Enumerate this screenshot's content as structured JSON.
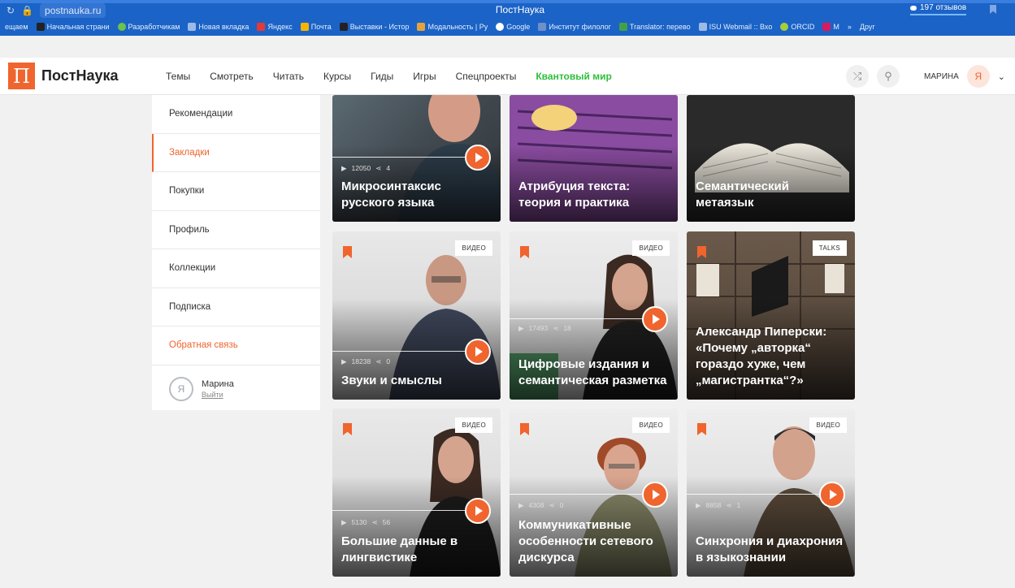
{
  "browser": {
    "url": "postnauka.ru",
    "title": "ПостНаука",
    "reviews": "197 отзывов",
    "bookmarks": [
      "ещаем",
      "Начальная страни",
      "Разработчикам",
      "Новая вкладка",
      "Яндекс",
      "Почта",
      "Выставки - Истор",
      "Модальность | Ру",
      "Google",
      "Институт филолог",
      "Translator: перево",
      "ISU Webmail :: Вхо",
      "ORCID",
      "M",
      "»",
      "Друг"
    ]
  },
  "header": {
    "logo_mark": "П",
    "logo_name": "ПостНаука",
    "nav": [
      "Темы",
      "Смотреть",
      "Читать",
      "Курсы",
      "Гиды",
      "Игры",
      "Спецпроекты"
    ],
    "nav_highlight": "Квантовый мир",
    "user_name": "МАРИНА",
    "avatar_letter": "Я"
  },
  "menu": {
    "items": [
      "Рекомендации",
      "Закладки",
      "Покупки",
      "Профиль",
      "Коллекции",
      "Подписка"
    ],
    "active_index": 1,
    "feedback": "Обратная связь",
    "user": "Марина",
    "logout": "Выйти"
  },
  "cards": [
    {
      "title": "Микросинтаксис русского языка",
      "views": "12050",
      "shares": "4",
      "badge": ""
    },
    {
      "title": "Атрибуция текста: теория и практика",
      "views": "",
      "shares": "",
      "badge": ""
    },
    {
      "title": "Семантический метаязык",
      "views": "",
      "shares": "",
      "badge": ""
    },
    {
      "title": "Звуки и смыслы",
      "views": "18238",
      "shares": "0",
      "badge": "ВИДЕО"
    },
    {
      "title": "Цифровые издания и семантическая разметка",
      "views": "17493",
      "shares": "18",
      "badge": "ВИДЕО"
    },
    {
      "title": "Александр Пиперски: «Почему „авторка“ гораздо хуже, чем „магистрантка“?»",
      "views": "",
      "shares": "",
      "badge": "TALKS"
    },
    {
      "title": "Большие данные в лингвистике",
      "views": "5130",
      "shares": "56",
      "badge": "ВИДЕО"
    },
    {
      "title": "Коммуникативные особенности сетевого дискурса",
      "views": "4308",
      "shares": "0",
      "badge": "ВИДЕО"
    },
    {
      "title": "Синхрония и диахрония в языкознании",
      "views": "8858",
      "shares": "1",
      "badge": "ВИДЕО"
    }
  ],
  "colors": {
    "accent": "#f0642e",
    "highlight": "#2fbf3a",
    "chrome": "#1b63c6"
  }
}
